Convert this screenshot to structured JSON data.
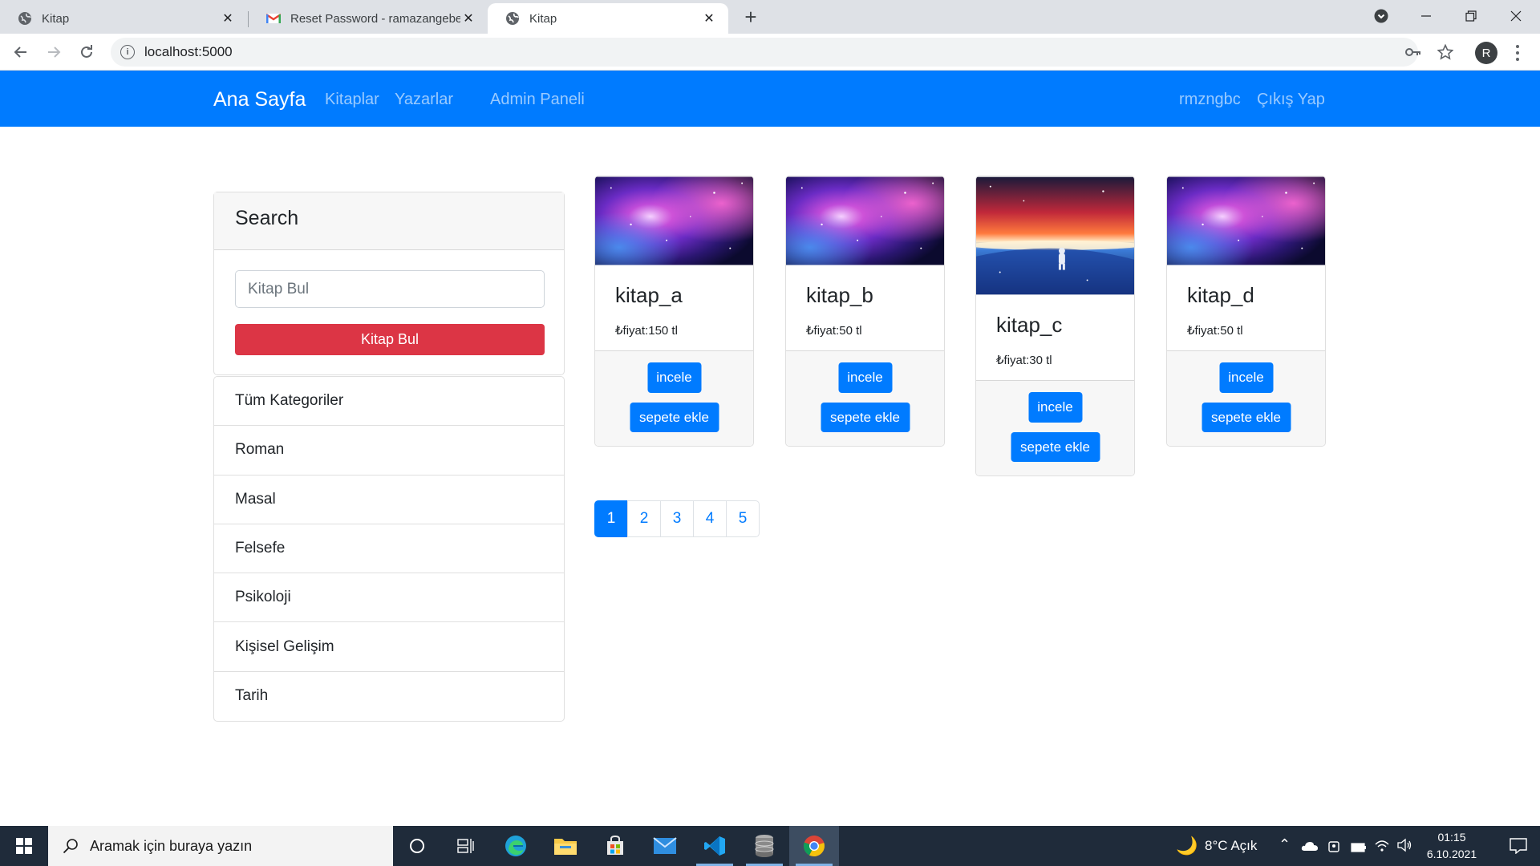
{
  "browser": {
    "tabs": [
      {
        "title": "Kitap",
        "icon": "globe-icon",
        "active": false
      },
      {
        "title": "Reset Password - ramazangebecek",
        "icon": "gmail-icon",
        "active": false
      },
      {
        "title": "Kitap",
        "icon": "globe-icon",
        "active": true
      }
    ],
    "url": "localhost:5000",
    "profile_initial": "R"
  },
  "navbar": {
    "brand": "Ana Sayfa",
    "links": [
      "Kitaplar",
      "Yazarlar",
      "Admin Paneli"
    ],
    "user": "rmzngbc",
    "logout": "Çıkış Yap",
    "color": "#007bff"
  },
  "sidebar": {
    "search_title": "Search",
    "search_placeholder": "Kitap Bul",
    "search_button": "Kitap Bul",
    "search_button_color": "#dc3545",
    "categories": [
      "Tüm Kategoriler",
      "Roman",
      "Masal",
      "Felsefe",
      "Psikoloji",
      "Kişisel Gelişim",
      "Tarih"
    ]
  },
  "books": [
    {
      "title": "kitap_a",
      "price": "₺fiyat:150 tl",
      "image": "galaxy-nebula",
      "detail_button": "incele",
      "cart_button": "sepete ekle"
    },
    {
      "title": "kitap_b",
      "price": "₺fiyat:50 tl",
      "image": "galaxy-nebula",
      "detail_button": "incele",
      "cart_button": "sepete ekle"
    },
    {
      "title": "kitap_c",
      "price": "₺fiyat:30 tl",
      "image": "astronaut-space",
      "detail_button": "incele",
      "cart_button": "sepete ekle"
    },
    {
      "title": "kitap_d",
      "price": "₺fiyat:50 tl",
      "image": "galaxy-nebula",
      "detail_button": "incele",
      "cart_button": "sepete ekle"
    }
  ],
  "pagination": {
    "pages": [
      "1",
      "2",
      "3",
      "4",
      "5"
    ],
    "active": "1"
  },
  "taskbar": {
    "search_placeholder": "Aramak için buraya yazın",
    "weather": "8°C  Açık",
    "time": "01:15",
    "date": "6.10.2021"
  }
}
